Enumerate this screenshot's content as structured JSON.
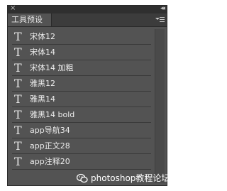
{
  "panel": {
    "tab_label": "工具预设",
    "close_glyph": "×",
    "collapse_glyph": "◂◂",
    "tab_close_glyph": "×"
  },
  "presets": [
    {
      "icon": "T",
      "label": "宋体12"
    },
    {
      "icon": "T",
      "label": "宋体14"
    },
    {
      "icon": "T",
      "label": "宋体14 加粗"
    },
    {
      "icon": "T",
      "label": "雅黑12"
    },
    {
      "icon": "T",
      "label": "雅黑14"
    },
    {
      "icon": "T",
      "label": "雅黑14 bold"
    },
    {
      "icon": "T",
      "label": "app导航34"
    },
    {
      "icon": "T",
      "label": "app正文28"
    },
    {
      "icon": "T",
      "label": "app注释20"
    }
  ],
  "watermark": {
    "text": "photoshop教程论坛"
  },
  "colors": {
    "panel_bg": "#535353",
    "tab_bar_bg": "#3c3c3c",
    "text": "#ececec"
  }
}
